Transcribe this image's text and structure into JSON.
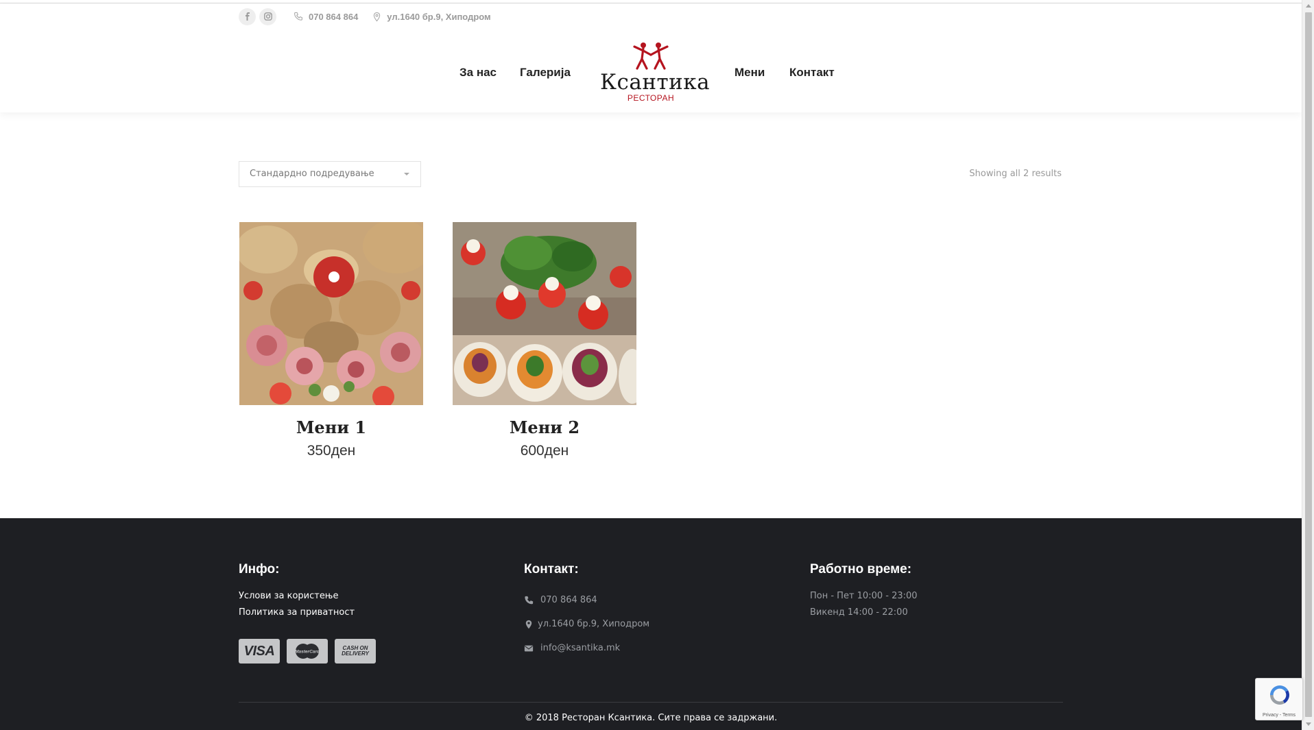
{
  "topbar": {
    "phone": "070 864 864",
    "address": "ул.1640 бр.9, Хиподром",
    "social": [
      "facebook-icon",
      "instagram-icon"
    ]
  },
  "nav": {
    "items": [
      {
        "label": "За нас"
      },
      {
        "label": "Галерија"
      },
      {
        "label": "Мени"
      },
      {
        "label": "Контакт"
      }
    ]
  },
  "logo": {
    "title": "Ксантика",
    "subtitle": "РЕСТОРАН"
  },
  "shop": {
    "sort_value": "Стандардно подредување",
    "results_text": "Showing all 2 results",
    "products": [
      {
        "name": "Мени 1",
        "price": "350ден"
      },
      {
        "name": "Мени 2",
        "price": "600ден"
      }
    ]
  },
  "footer": {
    "info": {
      "heading": "Инфо:",
      "links": [
        "Услови за користење",
        "Политика за приватност"
      ],
      "cards": [
        "VISA",
        "MasterCard",
        "CASH ON DELIVERY"
      ]
    },
    "contact": {
      "heading": "Контакт:",
      "phone": "070 864 864",
      "address": "ул.1640 бр.9, Хиподром",
      "email": "info@ksantika.mk"
    },
    "hours": {
      "heading": "Работно време:",
      "lines": [
        "Пон - Пет 10:00 - 23:00",
        "Викенд 14:00 - 22:00"
      ]
    },
    "copyright": "© 2018 Ресторан Ксантика. Сите права се задржани."
  },
  "recaptcha": {
    "links": "Privacy - Terms"
  },
  "colors": {
    "brand_red": "#b5141f",
    "footer_bg": "#1e1f23"
  }
}
